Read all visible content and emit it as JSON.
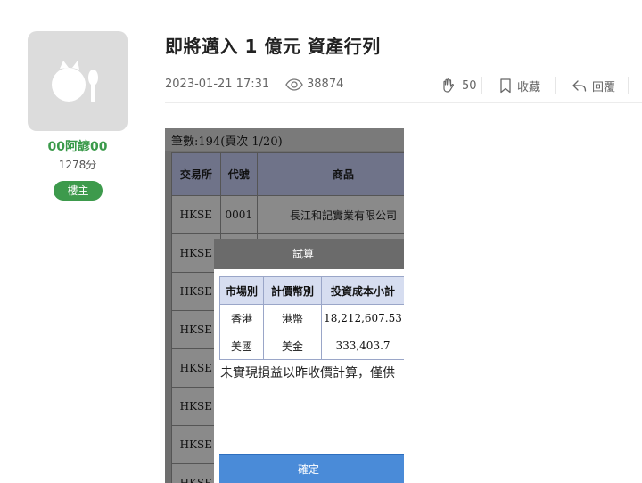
{
  "author": {
    "username": "00阿諺00",
    "points": "1278分",
    "badge": "樓主"
  },
  "post": {
    "title": "即將邁入 1 億元 資產行列",
    "datetime": "2023-01-21 17:31",
    "views": "38874",
    "likes": "50",
    "favorite_label": "收藏",
    "reply_label": "回覆"
  },
  "screenshot": {
    "count_line": "筆數:194(頁次 1/20)",
    "table": {
      "headers": [
        "交易所",
        "代號",
        "商品"
      ],
      "rows": [
        [
          "HKSE",
          "0001",
          "長江和記實業有限公司"
        ],
        [
          "HKSE",
          "",
          ""
        ],
        [
          "HKSE",
          "",
          ""
        ],
        [
          "HKSE",
          "",
          ""
        ],
        [
          "HKSE",
          "",
          ""
        ],
        [
          "HKSE",
          "",
          ""
        ],
        [
          "HKSE",
          "",
          ""
        ],
        [
          "HKSE",
          "",
          ""
        ]
      ]
    },
    "dialog": {
      "title": "試算",
      "headers": [
        "市場別",
        "計價幣別",
        "投資成本小計"
      ],
      "rows": [
        [
          "香港",
          "港幣",
          "18,212,607.53"
        ],
        [
          "美國",
          "美金",
          "333,403.7"
        ]
      ],
      "note": "未實現損益以昨收價計算，僅供",
      "confirm_label": "確定"
    }
  },
  "colors": {
    "accent_green": "#3d9a4c",
    "username_green": "#3a9a4a",
    "confirm_blue": "#4a8bd8"
  }
}
